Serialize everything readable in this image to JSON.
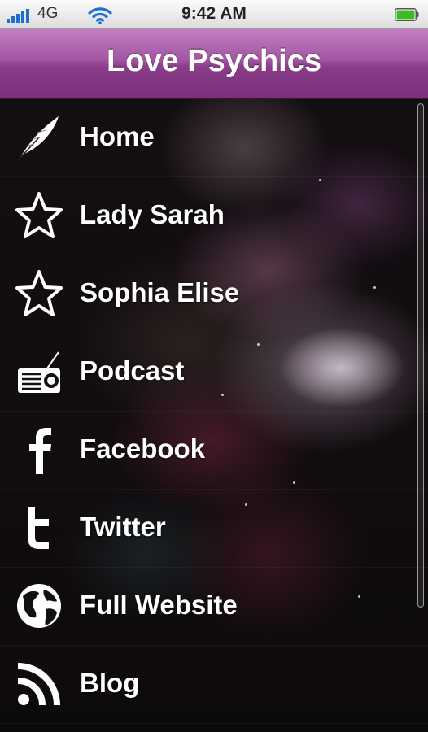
{
  "status_bar": {
    "carrier": "4G",
    "time": "9:42 AM",
    "signal_icon": "signal-bars-icon",
    "wifi_icon": "wifi-icon",
    "battery_icon": "battery-icon",
    "battery_color": "#3dbb27"
  },
  "header": {
    "title": "Love Psychics",
    "color": "#9b4f9b"
  },
  "menu": {
    "items": [
      {
        "label": "Home",
        "icon": "feather-icon"
      },
      {
        "label": "Lady Sarah",
        "icon": "star-icon"
      },
      {
        "label": "Sophia Elise",
        "icon": "star-icon"
      },
      {
        "label": "Podcast",
        "icon": "radio-icon"
      },
      {
        "label": "Facebook",
        "icon": "facebook-icon"
      },
      {
        "label": "Twitter",
        "icon": "twitter-icon"
      },
      {
        "label": "Full Website",
        "icon": "globe-icon"
      },
      {
        "label": "Blog",
        "icon": "rss-icon"
      }
    ]
  }
}
